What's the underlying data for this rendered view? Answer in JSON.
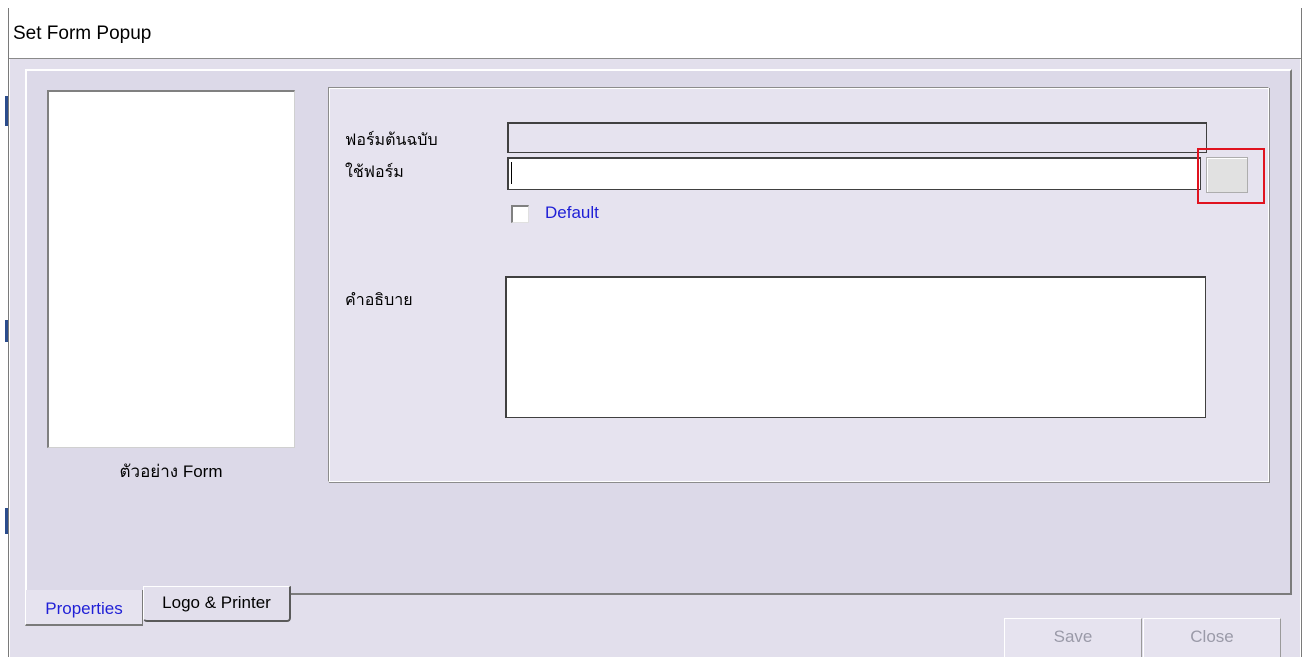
{
  "window": {
    "title": "Set Form Popup"
  },
  "preview": {
    "label": "ตัวอย่าง Form"
  },
  "properties": {
    "original_form_label": "ฟอร์มต้นฉบับ",
    "original_form_value": "",
    "use_form_label": "ใช้ฟอร์ม",
    "use_form_value": "",
    "default_label": "Default",
    "default_checked": false,
    "description_label": "คำอธิบาย",
    "description_value": ""
  },
  "tabs": [
    {
      "label": "Properties",
      "active": true
    },
    {
      "label": "Logo & Printer",
      "active": false
    }
  ],
  "buttons": {
    "save_label": "Save",
    "close_label": "Close"
  },
  "colors": {
    "dialog_bg": "#e2dfec",
    "active_tab_text": "#1f1fd6",
    "highlight": "#e0131f"
  }
}
